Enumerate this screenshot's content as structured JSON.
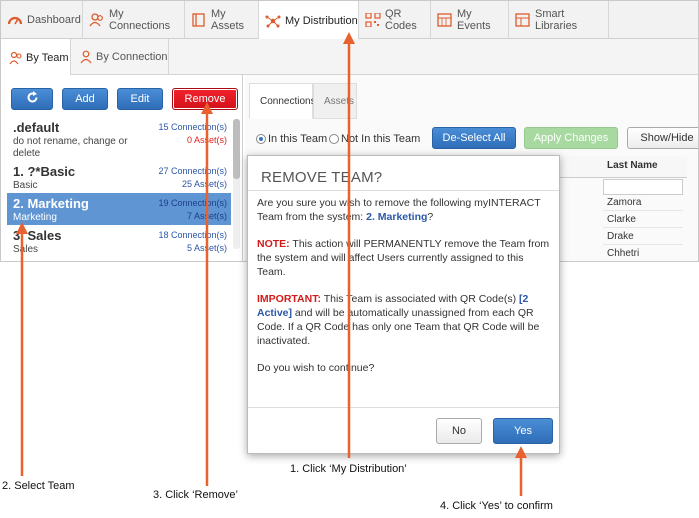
{
  "topnav": {
    "tabs": [
      {
        "label": "Dashboard",
        "icon": "gauge-icon"
      },
      {
        "label": "My Connections",
        "icon": "people-icon"
      },
      {
        "label": "My Assets",
        "icon": "folder-icon"
      },
      {
        "label": "My Distribution",
        "icon": "network-icon",
        "active": true
      },
      {
        "label": "QR Codes",
        "icon": "qr-icon"
      },
      {
        "label": "My Events",
        "icon": "calendar-icon"
      },
      {
        "label": "Smart Libraries",
        "icon": "library-icon"
      }
    ]
  },
  "subnav": {
    "tabs": [
      {
        "label": "By Team",
        "active": true
      },
      {
        "label": "By Connection"
      }
    ]
  },
  "toolbar": {
    "refresh_icon": "refresh-icon",
    "add_label": "Add",
    "edit_label": "Edit",
    "remove_label": "Remove"
  },
  "teams": [
    {
      "name": ".default",
      "sub": "do not rename, change or delete",
      "connections": "15 Connection(s)",
      "assets": "0 Asset(s)"
    },
    {
      "name": "1. ?*Basic",
      "sub": "Basic",
      "connections": "27 Connection(s)",
      "assets": "25 Asset(s)"
    },
    {
      "name": "2. Marketing",
      "sub": "Marketing",
      "connections": "19 Connection(s)",
      "assets": "7 Asset(s)",
      "selected": true
    },
    {
      "name": "3. Sales",
      "sub": "Sales",
      "connections": "18 Connection(s)",
      "assets": "5 Asset(s)"
    }
  ],
  "right": {
    "tabs": [
      "Connections",
      "Assets"
    ],
    "radio_in_team": "In this Team",
    "radio_not_in_team": "Not In this Team",
    "deselect_all": "De-Select All",
    "apply_changes": "Apply Changes",
    "show_hide": "Show/Hide",
    "last_name_header": "Last Name",
    "last_names": [
      "Zamora",
      "Clarke",
      "Drake",
      "Chhetri"
    ]
  },
  "modal": {
    "title": "REMOVE TEAM?",
    "line1_prefix": "Are you sure you wish to remove the following myINTERACT Team from the system: ",
    "line1_team": "2. Marketing",
    "line1_suffix": "?",
    "note_label": "NOTE:",
    "note_text": " This action will PERMANENTLY remove the Team from the system and will affect Users currently assigned to this Team.",
    "important_label": "IMPORTANT:",
    "important_text1": " This Team is associated with QR Code(s) ",
    "important_count": "[2 Active]",
    "important_text2": " and will be automatically unassigned from each QR Code. If a QR Code has only one Team that QR Code will be inactivated.",
    "question": "Do you wish to continue?",
    "no_label": "No",
    "yes_label": "Yes"
  },
  "annotations": {
    "step1": "1. Click ‘My Distribution’",
    "step2": "2. Select Team",
    "step3": "3. Click ‘Remove’",
    "step4": "4. Click ‘Yes’ to confirm",
    "arrow_color": "#e8622f"
  },
  "colors": {
    "primary_blue": "#2f6db8",
    "danger_red": "#d2121a",
    "selected_row": "#5f95d3",
    "apply_green": "#a7d9a0"
  }
}
